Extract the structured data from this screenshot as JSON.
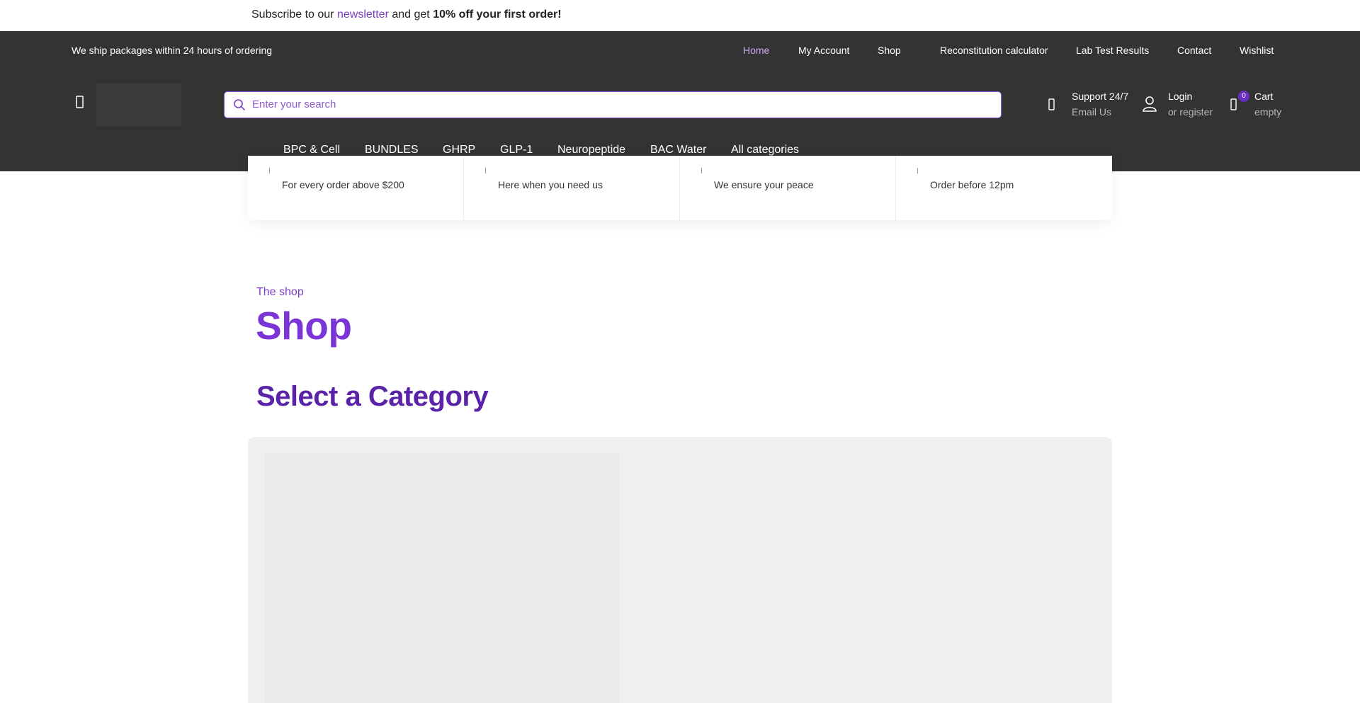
{
  "newsletter": {
    "prefix": "Subscribe to our",
    "link": "newsletter",
    "middle": "and get",
    "offer": "10% off your first order!"
  },
  "header": {
    "ship_note": "We ship packages within 24 hours of ordering",
    "topnav": [
      "Home",
      "My Account",
      "Shop",
      "Reconstitution calculator",
      "Lab Test Results",
      "Contact",
      "Wishlist"
    ],
    "search_placeholder": "Enter your search",
    "support": {
      "title": "Support 24/7",
      "sub": "Email Us"
    },
    "account": {
      "title": "Login",
      "sub": "or register"
    },
    "cart": {
      "count": "0",
      "title": "Cart",
      "sub": "empty"
    },
    "categories": [
      "BPC & Cell",
      "BUNDLES",
      "GHRP",
      "GLP-1",
      "Neuropeptide",
      "BAC Water",
      "All categories"
    ]
  },
  "features": [
    {
      "sub": "For every order above $200"
    },
    {
      "sub": "Here when you need us"
    },
    {
      "sub": "We ensure your peace"
    },
    {
      "sub": "Order before 12pm"
    }
  ],
  "shop": {
    "eyebrow": "The shop",
    "title": "Shop",
    "section_title": "Select a Category"
  },
  "colors": {
    "header_bg": "#333333",
    "accent": "#7b35d6",
    "accent_dark": "#5a23a8",
    "active_nav": "#c9a8f3"
  }
}
